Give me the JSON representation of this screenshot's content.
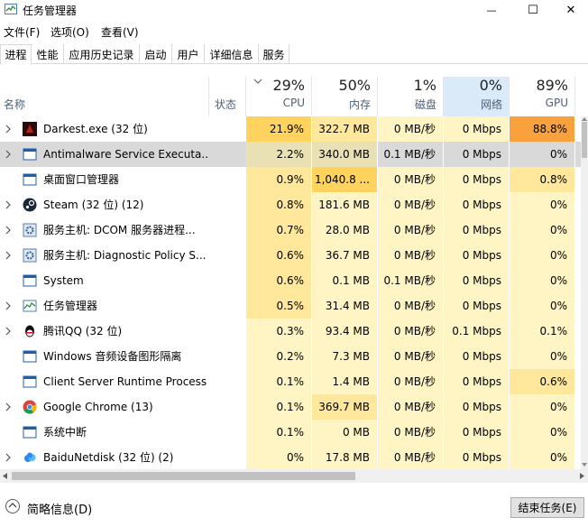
{
  "window": {
    "title": "任务管理器",
    "minimize": "—",
    "maximize": "☐",
    "close": "✕"
  },
  "menu": [
    "文件(F)",
    "选项(O)",
    "查看(V)"
  ],
  "tabs": [
    "进程",
    "性能",
    "应用历史记录",
    "启动",
    "用户",
    "详细信息",
    "服务"
  ],
  "header": {
    "name": "名称",
    "status": "状态",
    "cpu_pct": "29%",
    "cpu": "CPU",
    "mem_pct": "50%",
    "mem": "内存",
    "disk_pct": "1%",
    "disk": "磁盘",
    "net_pct": "0%",
    "net": "网络",
    "gpu_pct": "89%",
    "gpu": "GPU",
    "sort_icon": "chevron-down"
  },
  "processes": [
    {
      "name": "Darkest.exe (32 位)",
      "icon": "darkest",
      "expand": true,
      "cpu": "21.9%",
      "mem": "322.7 MB",
      "disk": "0 MB/秒",
      "net": "0 Mbps",
      "gpu": "88.8%"
    },
    {
      "name": "Antimalware Service Executa...",
      "icon": "window",
      "expand": true,
      "cpu": "2.2%",
      "mem": "340.0 MB",
      "disk": "0.1 MB/秒",
      "net": "0 Mbps",
      "gpu": "0%"
    },
    {
      "name": "桌面窗口管理器",
      "icon": "window",
      "expand": false,
      "cpu": "0.9%",
      "mem": "1,040.8 ...",
      "disk": "0 MB/秒",
      "net": "0 Mbps",
      "gpu": "0.8%"
    },
    {
      "name": "Steam (32 位) (12)",
      "icon": "steam",
      "expand": true,
      "cpu": "0.8%",
      "mem": "181.6 MB",
      "disk": "0 MB/秒",
      "net": "0 Mbps",
      "gpu": "0%"
    },
    {
      "name": "服务主机: DCOM 服务器进程...",
      "icon": "gear",
      "expand": true,
      "cpu": "0.7%",
      "mem": "28.0 MB",
      "disk": "0 MB/秒",
      "net": "0 Mbps",
      "gpu": "0%"
    },
    {
      "name": "服务主机: Diagnostic Policy S...",
      "icon": "gear",
      "expand": true,
      "cpu": "0.6%",
      "mem": "36.7 MB",
      "disk": "0 MB/秒",
      "net": "0 Mbps",
      "gpu": "0%"
    },
    {
      "name": "System",
      "icon": "window",
      "expand": false,
      "cpu": "0.6%",
      "mem": "0.1 MB",
      "disk": "0.1 MB/秒",
      "net": "0 Mbps",
      "gpu": "0%"
    },
    {
      "name": "任务管理器",
      "icon": "taskmgr",
      "expand": true,
      "cpu": "0.5%",
      "mem": "31.4 MB",
      "disk": "0 MB/秒",
      "net": "0 Mbps",
      "gpu": "0%"
    },
    {
      "name": "腾讯QQ (32 位)",
      "icon": "qq",
      "expand": true,
      "cpu": "0.3%",
      "mem": "93.4 MB",
      "disk": "0 MB/秒",
      "net": "0.1 Mbps",
      "gpu": "0.1%"
    },
    {
      "name": "Windows 音频设备图形隔离",
      "icon": "window",
      "expand": false,
      "cpu": "0.2%",
      "mem": "7.3 MB",
      "disk": "0 MB/秒",
      "net": "0 Mbps",
      "gpu": "0%"
    },
    {
      "name": "Client Server Runtime Process",
      "icon": "window",
      "expand": false,
      "cpu": "0.1%",
      "mem": "1.4 MB",
      "disk": "0 MB/秒",
      "net": "0 Mbps",
      "gpu": "0.6%"
    },
    {
      "name": "Google Chrome (13)",
      "icon": "chrome",
      "expand": true,
      "cpu": "0.1%",
      "mem": "369.7 MB",
      "disk": "0 MB/秒",
      "net": "0 Mbps",
      "gpu": "0%"
    },
    {
      "name": "系统中断",
      "icon": "window",
      "expand": false,
      "cpu": "0.1%",
      "mem": "0 MB",
      "disk": "0 MB/秒",
      "net": "0 Mbps",
      "gpu": "0%"
    },
    {
      "name": "BaiduNetdisk (32 位) (2)",
      "icon": "baidu",
      "expand": true,
      "cpu": "0%",
      "mem": "17.8 MB",
      "disk": "0 MB/秒",
      "net": "0 Mbps",
      "gpu": "0%"
    }
  ],
  "footer": {
    "fewer_details": "简略信息(D)",
    "end_task": "结束任务(E)"
  },
  "colors": {
    "heat_light": "#fff4c4",
    "heat_mid": "#ffe89b",
    "heat_strong": "#ffd35e",
    "heat_hot": "#f8a13d",
    "net_header": "#dbeaf8",
    "selected": "#d9d9d9"
  }
}
